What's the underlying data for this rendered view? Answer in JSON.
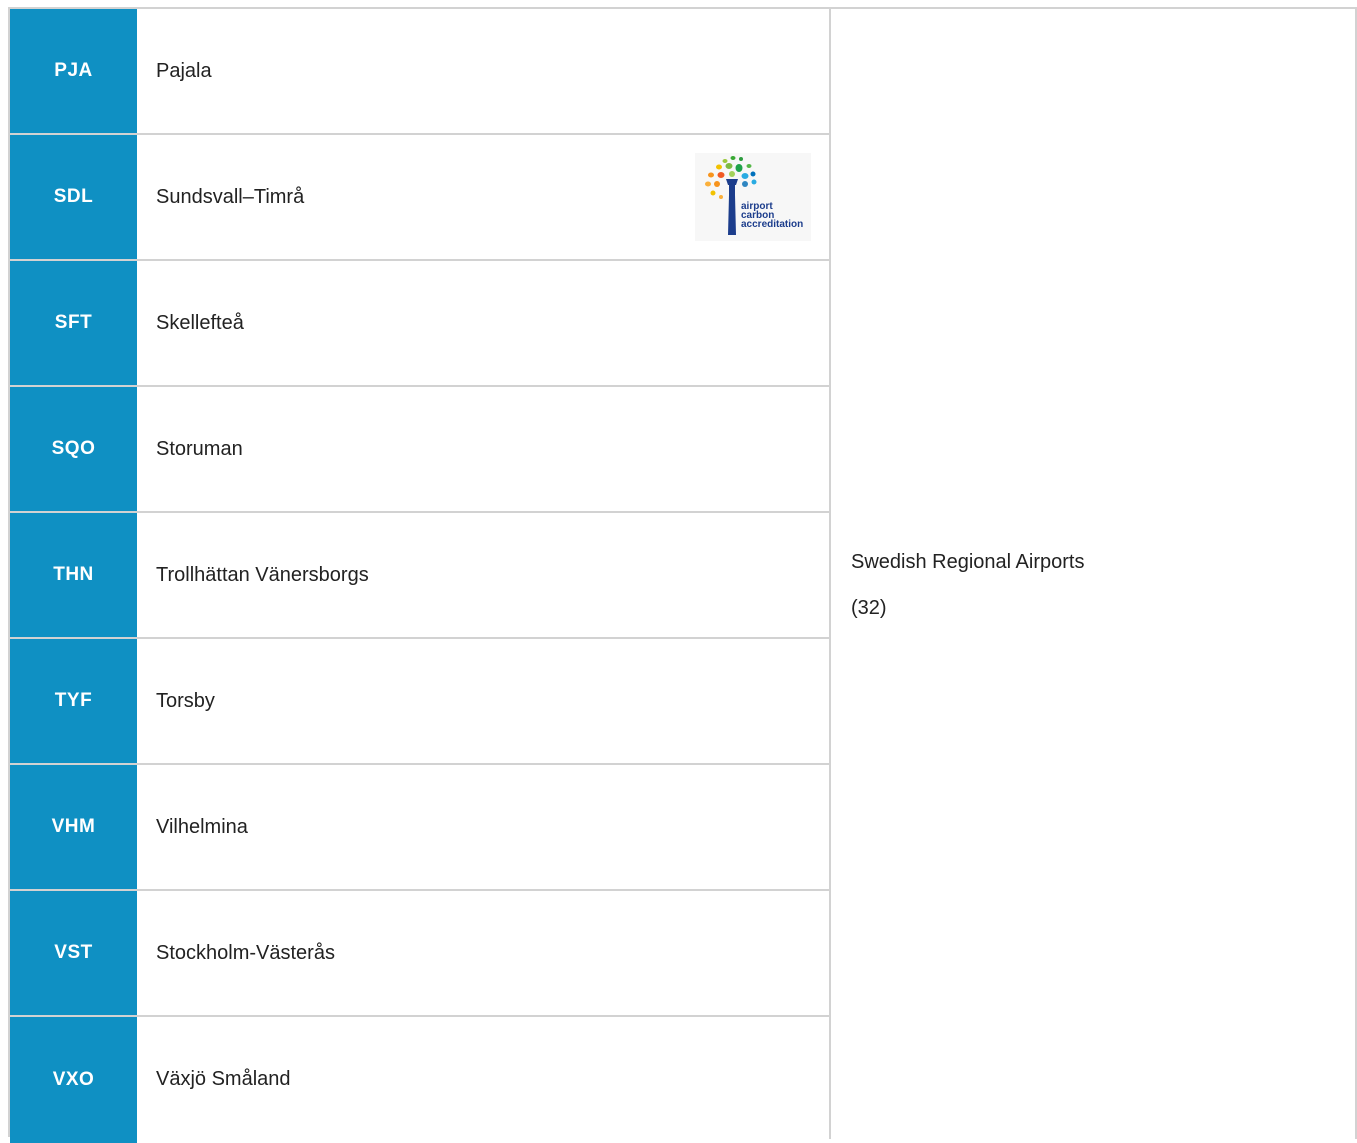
{
  "airports": [
    {
      "code": "PJA",
      "name": "Pajala",
      "has_logo": false
    },
    {
      "code": "SDL",
      "name": "Sundsvall–Timrå",
      "has_logo": true
    },
    {
      "code": "SFT",
      "name": "Skellefteå",
      "has_logo": false
    },
    {
      "code": "SQO",
      "name": "Storuman",
      "has_logo": false
    },
    {
      "code": "THN",
      "name": "Trollhättan Vänersborgs",
      "has_logo": false
    },
    {
      "code": "TYF",
      "name": "Torsby",
      "has_logo": false
    },
    {
      "code": "VHM",
      "name": "Vilhelmina",
      "has_logo": false
    },
    {
      "code": "VST",
      "name": "Stockholm-Västerås",
      "has_logo": false
    },
    {
      "code": "VXO",
      "name": "Växjö Småland",
      "has_logo": false
    }
  ],
  "group": {
    "name": "Swedish Regional Airports",
    "count": "(32)"
  },
  "logo": {
    "line1": "airport",
    "line2": "carbon",
    "line3": "accreditation",
    "icon": "airport-carbon-accreditation-logo"
  },
  "colors": {
    "code_bg": "#0f90c3",
    "code_text": "#ffffff",
    "border": "#d2d2d2",
    "logo_blue": "#1c3d8c"
  }
}
